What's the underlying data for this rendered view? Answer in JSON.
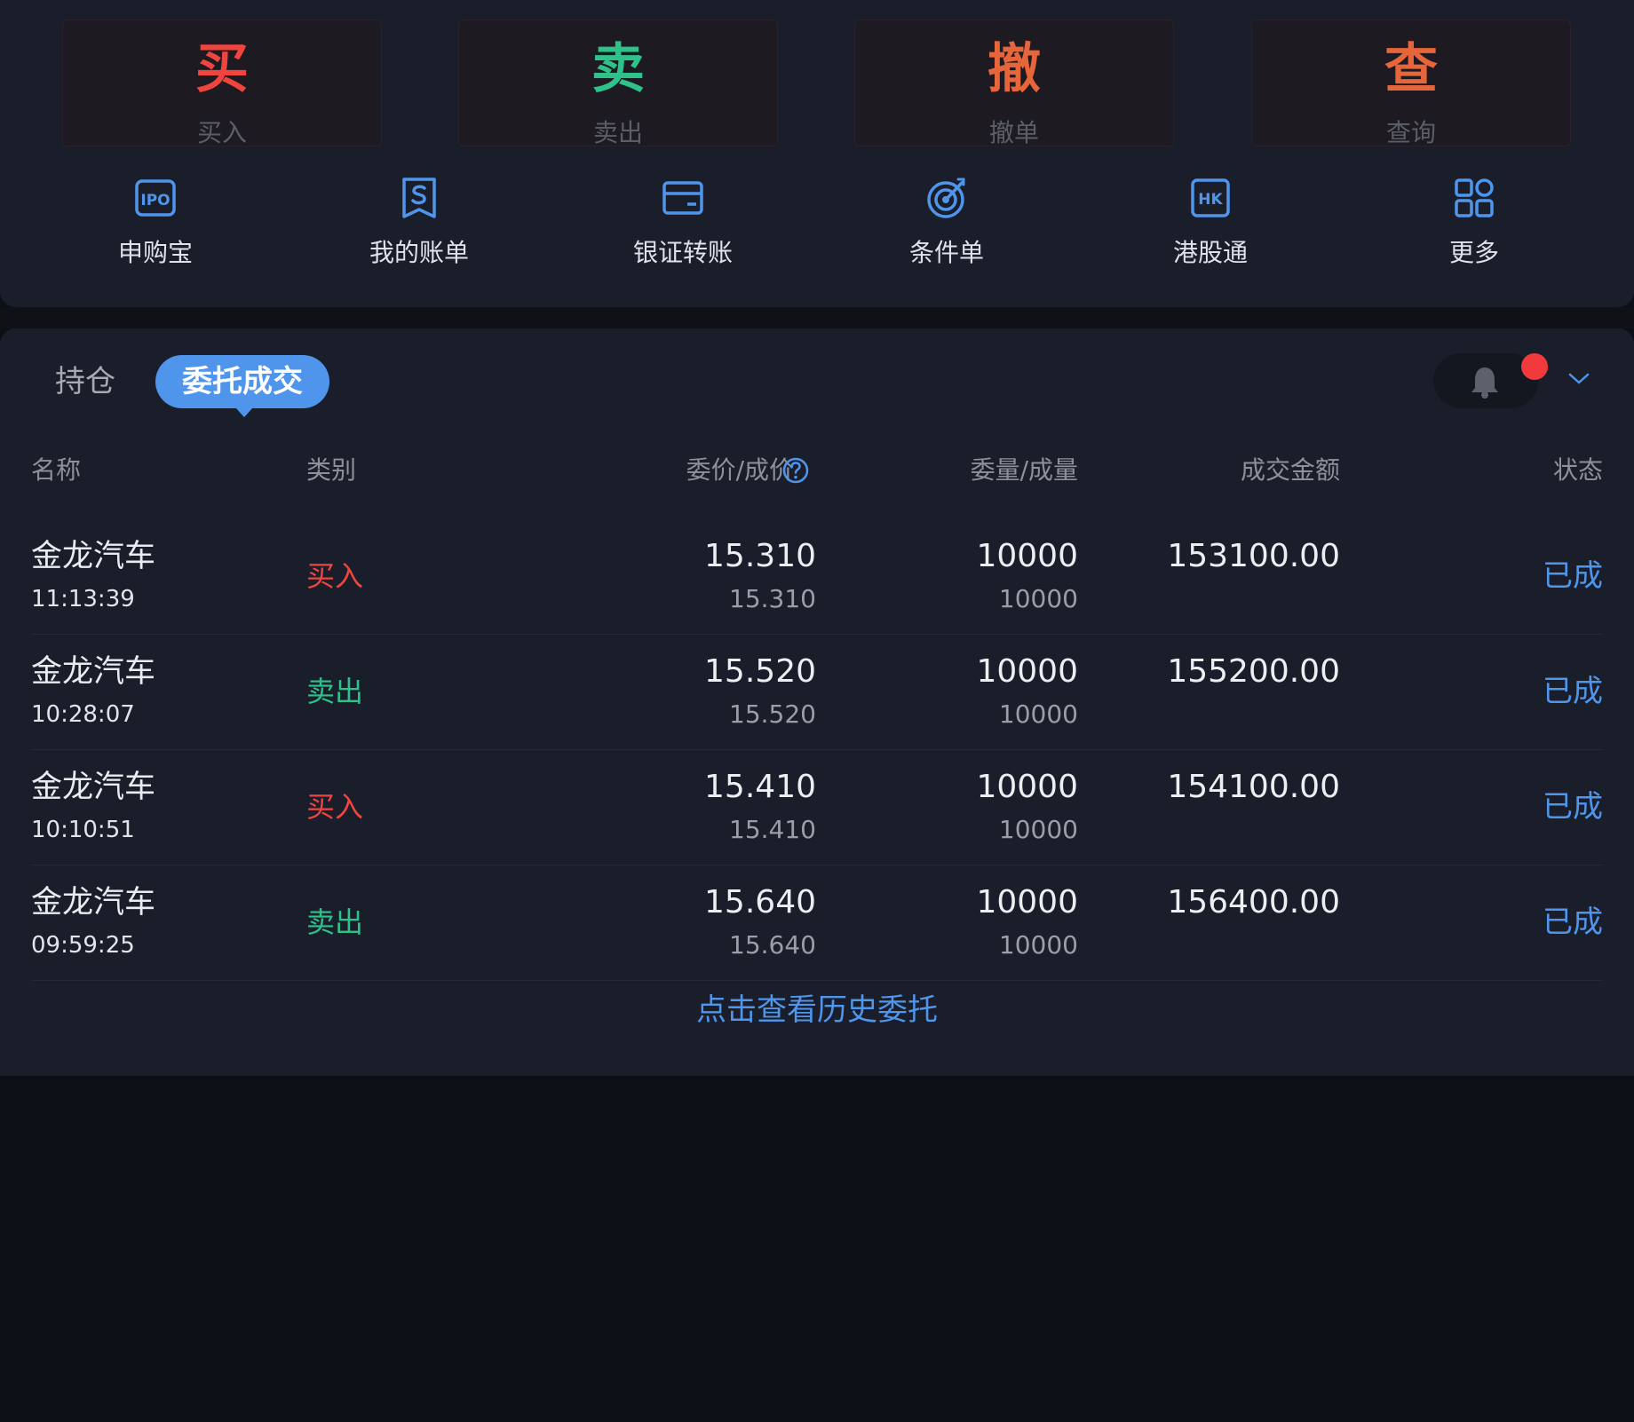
{
  "colors": {
    "buy": "#f0453f",
    "sell": "#2ec28a",
    "cancel": "#e7653a",
    "query": "#e7653a",
    "accent": "#4f95ec"
  },
  "trade_buttons": [
    {
      "big": "买",
      "small": "买入"
    },
    {
      "big": "卖",
      "small": "卖出"
    },
    {
      "big": "撤",
      "small": "撤单"
    },
    {
      "big": "查",
      "small": "查询"
    }
  ],
  "shortcuts": [
    {
      "label": "申购宝",
      "icon": "ipo-icon",
      "icon_text": "IPO"
    },
    {
      "label": "我的账单",
      "icon": "bill-icon"
    },
    {
      "label": "银证转账",
      "icon": "card-icon"
    },
    {
      "label": "条件单",
      "icon": "target-icon"
    },
    {
      "label": "港股通",
      "icon": "hk-icon",
      "icon_text": "HK"
    },
    {
      "label": "更多",
      "icon": "grid-icon"
    }
  ],
  "tabs": {
    "holdings": "持仓",
    "orders": "委托成交"
  },
  "columns": {
    "name": "名称",
    "type": "类别",
    "price": "委价/成价",
    "qty": "委量/成量",
    "amount": "成交金额",
    "status": "状态"
  },
  "orders": [
    {
      "name": "金龙汽车",
      "time": "11:13:39",
      "type": "买入",
      "side": "buy",
      "order_price": "15.310",
      "deal_price": "15.310",
      "order_qty": "10000",
      "deal_qty": "10000",
      "amount": "153100.00",
      "status": "已成"
    },
    {
      "name": "金龙汽车",
      "time": "10:28:07",
      "type": "卖出",
      "side": "sell",
      "order_price": "15.520",
      "deal_price": "15.520",
      "order_qty": "10000",
      "deal_qty": "10000",
      "amount": "155200.00",
      "status": "已成"
    },
    {
      "name": "金龙汽车",
      "time": "10:10:51",
      "type": "买入",
      "side": "buy",
      "order_price": "15.410",
      "deal_price": "15.410",
      "order_qty": "10000",
      "deal_qty": "10000",
      "amount": "154100.00",
      "status": "已成"
    },
    {
      "name": "金龙汽车",
      "time": "09:59:25",
      "type": "卖出",
      "side": "sell",
      "order_price": "15.640",
      "deal_price": "15.640",
      "order_qty": "10000",
      "deal_qty": "10000",
      "amount": "156400.00",
      "status": "已成"
    }
  ],
  "history_link": "点击查看历史委托"
}
